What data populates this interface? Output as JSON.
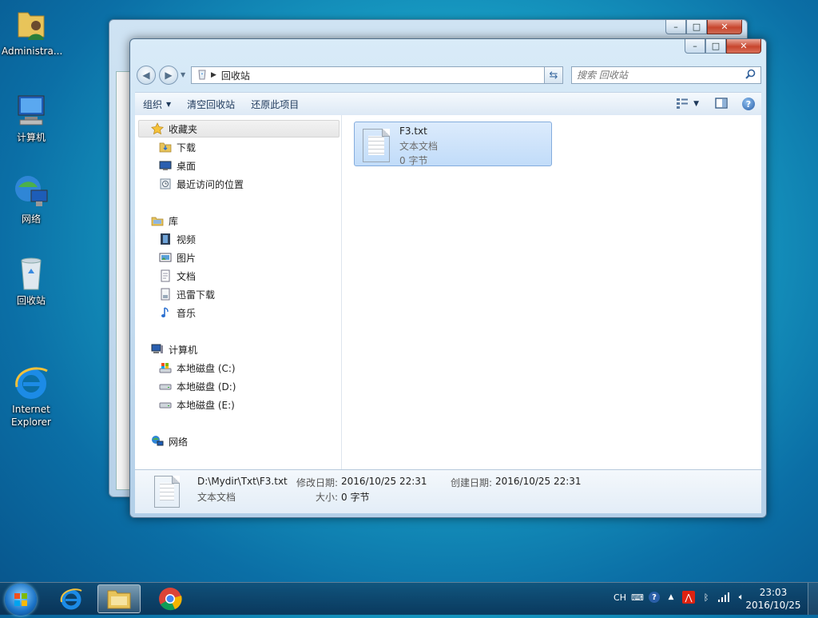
{
  "desktop": {
    "icons": [
      {
        "label": "Administra...",
        "icon": "user-folder-icon"
      },
      {
        "label": "计算机",
        "icon": "computer-icon"
      },
      {
        "label": "网络",
        "icon": "network-icon"
      },
      {
        "label": "回收站",
        "icon": "recycle-bin-icon"
      },
      {
        "label": "Internet\nExplorer",
        "icon": "ie-icon"
      }
    ]
  },
  "explorer": {
    "address": {
      "path": "回收站"
    },
    "search": {
      "placeholder": "搜索 回收站"
    },
    "toolbar": {
      "organize": "组织",
      "empty_bin": "清空回收站",
      "restore_all": "还原此项目"
    },
    "nav": {
      "favorites": "收藏夹",
      "fav_items": [
        "下载",
        "桌面",
        "最近访问的位置"
      ],
      "libraries": "库",
      "lib_items": [
        "视频",
        "图片",
        "文档",
        "迅雷下载",
        "音乐"
      ],
      "computer": "计算机",
      "drives": [
        "本地磁盘 (C:)",
        "本地磁盘 (D:)",
        "本地磁盘 (E:)"
      ],
      "network": "网络"
    },
    "file": {
      "name": "F3.txt",
      "type": "文本文档",
      "size": "0 字节"
    },
    "details": {
      "path": "D:\\Mydir\\Txt\\F3.txt",
      "type": "文本文档",
      "modified_label": "修改日期:",
      "modified": "2016/10/25 22:31",
      "created_label": "创建日期:",
      "created": "2016/10/25 22:31",
      "size_label": "大小:",
      "size": "0 字节"
    }
  },
  "taskbar": {
    "lang": "CH",
    "time": "23:03",
    "date": "2016/10/25"
  }
}
